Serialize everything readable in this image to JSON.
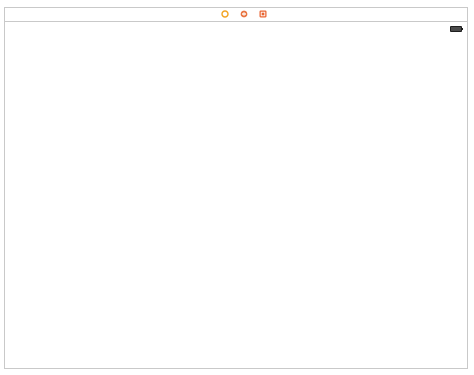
{
  "toolbar": {
    "icons": [
      {
        "name": "view-controller-icon",
        "color": "#f2a21d"
      },
      {
        "name": "first-responder-icon",
        "color": "#e8733f"
      },
      {
        "name": "exit-icon",
        "color": "#e8622f"
      }
    ]
  },
  "status_bar": {
    "battery": "battery-icon"
  },
  "colors": {
    "border": "#c9c9c9",
    "background": "#ffffff",
    "orange": "#f2a21d",
    "red_orange": "#e8622f"
  }
}
